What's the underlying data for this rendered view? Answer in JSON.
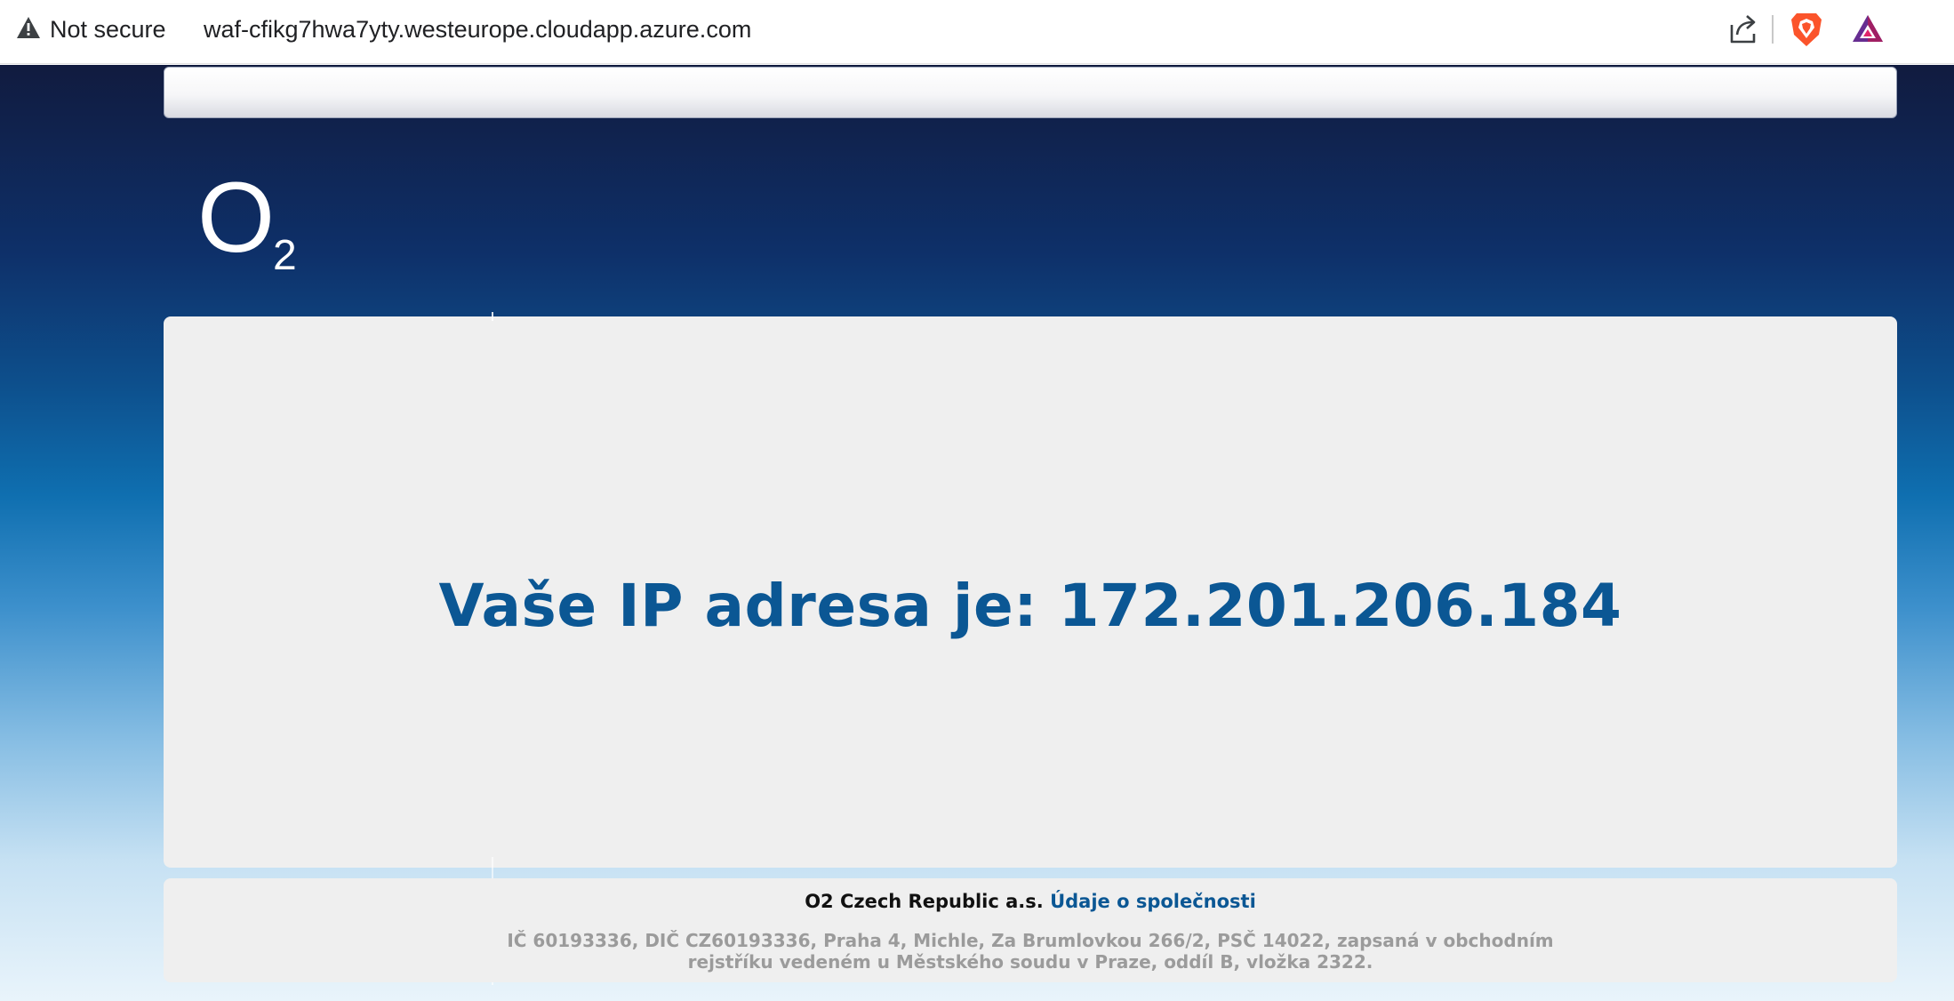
{
  "browser": {
    "security_label": "Not secure",
    "url": "waf-cfikg7hwa7yty.westeurope.cloudapp.azure.com",
    "icons": [
      "warning-icon",
      "share-icon",
      "brave-shield-icon",
      "brave-rewards-icon"
    ]
  },
  "page": {
    "logo": {
      "text": "O",
      "subscript": "2"
    },
    "ip_heading": "Vaše IP adresa je: 172.201.206.184",
    "footer": {
      "company": "O2 Czech Republic a.s.",
      "company_link": "Údaje o společnosti",
      "legal_line1": "IČ 60193336, DIČ CZ60193336, Praha 4, Michle, Za Brumlovkou 266/2, PSČ 14022, zapsaná v obchodním",
      "legal_line2": "rejstříku vedeném u Městského soudu v Praze, oddíl B, vložka 2322."
    }
  },
  "colors": {
    "heading": "#0b5794",
    "panel": "#efefef",
    "gradient_top": "#111b3f",
    "gradient_bottom": "#e9f4fb",
    "brave_orange": "#fb542b",
    "legal_text": "#9b9b9b"
  }
}
